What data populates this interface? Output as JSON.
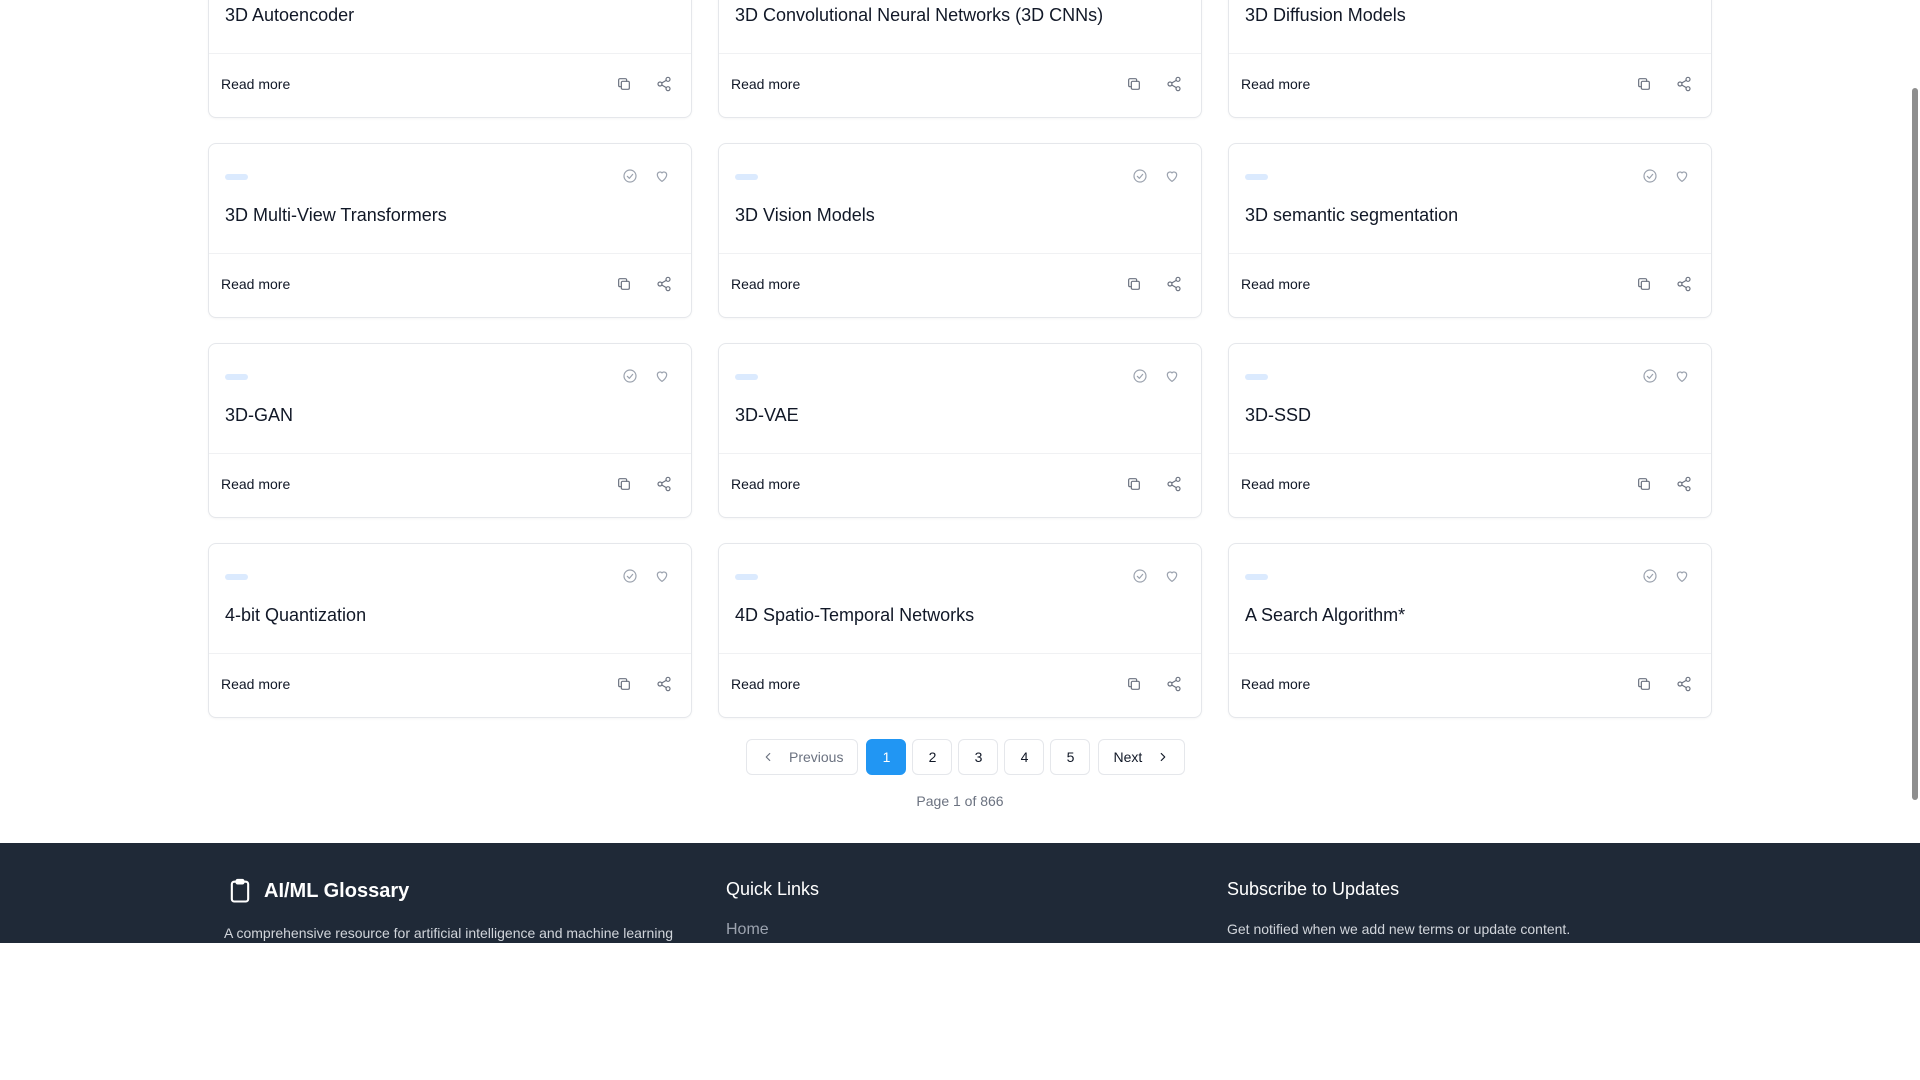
{
  "cards": [
    {
      "title": "3D Autoencoder",
      "read_more": "Read more"
    },
    {
      "title": "3D Convolutional Neural Networks (3D CNNs)",
      "read_more": "Read more"
    },
    {
      "title": "3D Diffusion Models",
      "read_more": "Read more"
    },
    {
      "title": "3D Multi-View Transformers",
      "read_more": "Read more"
    },
    {
      "title": "3D Vision Models",
      "read_more": "Read more"
    },
    {
      "title": "3D semantic segmentation",
      "read_more": "Read more"
    },
    {
      "title": "3D-GAN",
      "read_more": "Read more"
    },
    {
      "title": "3D-VAE",
      "read_more": "Read more"
    },
    {
      "title": "3D-SSD",
      "read_more": "Read more"
    },
    {
      "title": "4-bit Quantization",
      "read_more": "Read more"
    },
    {
      "title": "4D Spatio-Temporal Networks",
      "read_more": "Read more"
    },
    {
      "title": "A Search Algorithm*",
      "read_more": "Read more"
    }
  ],
  "pagination": {
    "previous": "Previous",
    "next": "Next",
    "pages": [
      "1",
      "2",
      "3",
      "4",
      "5"
    ],
    "current_page": 1,
    "info": "Page 1 of 866"
  },
  "footer": {
    "brand": "AI/ML Glossary",
    "description": "A comprehensive resource for artificial intelligence and machine learning",
    "quick_links_title": "Quick Links",
    "quick_links": [
      "Home"
    ],
    "subscribe_title": "Subscribe to Updates",
    "subscribe_text": "Get notified when we add new terms or update content."
  },
  "colors": {
    "accent": "#2196f3",
    "footer_bg": "#1f2937",
    "tag_pill": "#dbeafe"
  },
  "icons": {
    "card_top": [
      "check-circle-icon",
      "heart-icon"
    ],
    "card_bottom": [
      "copy-icon",
      "share-icon"
    ],
    "brand": "clipboard-icon"
  }
}
